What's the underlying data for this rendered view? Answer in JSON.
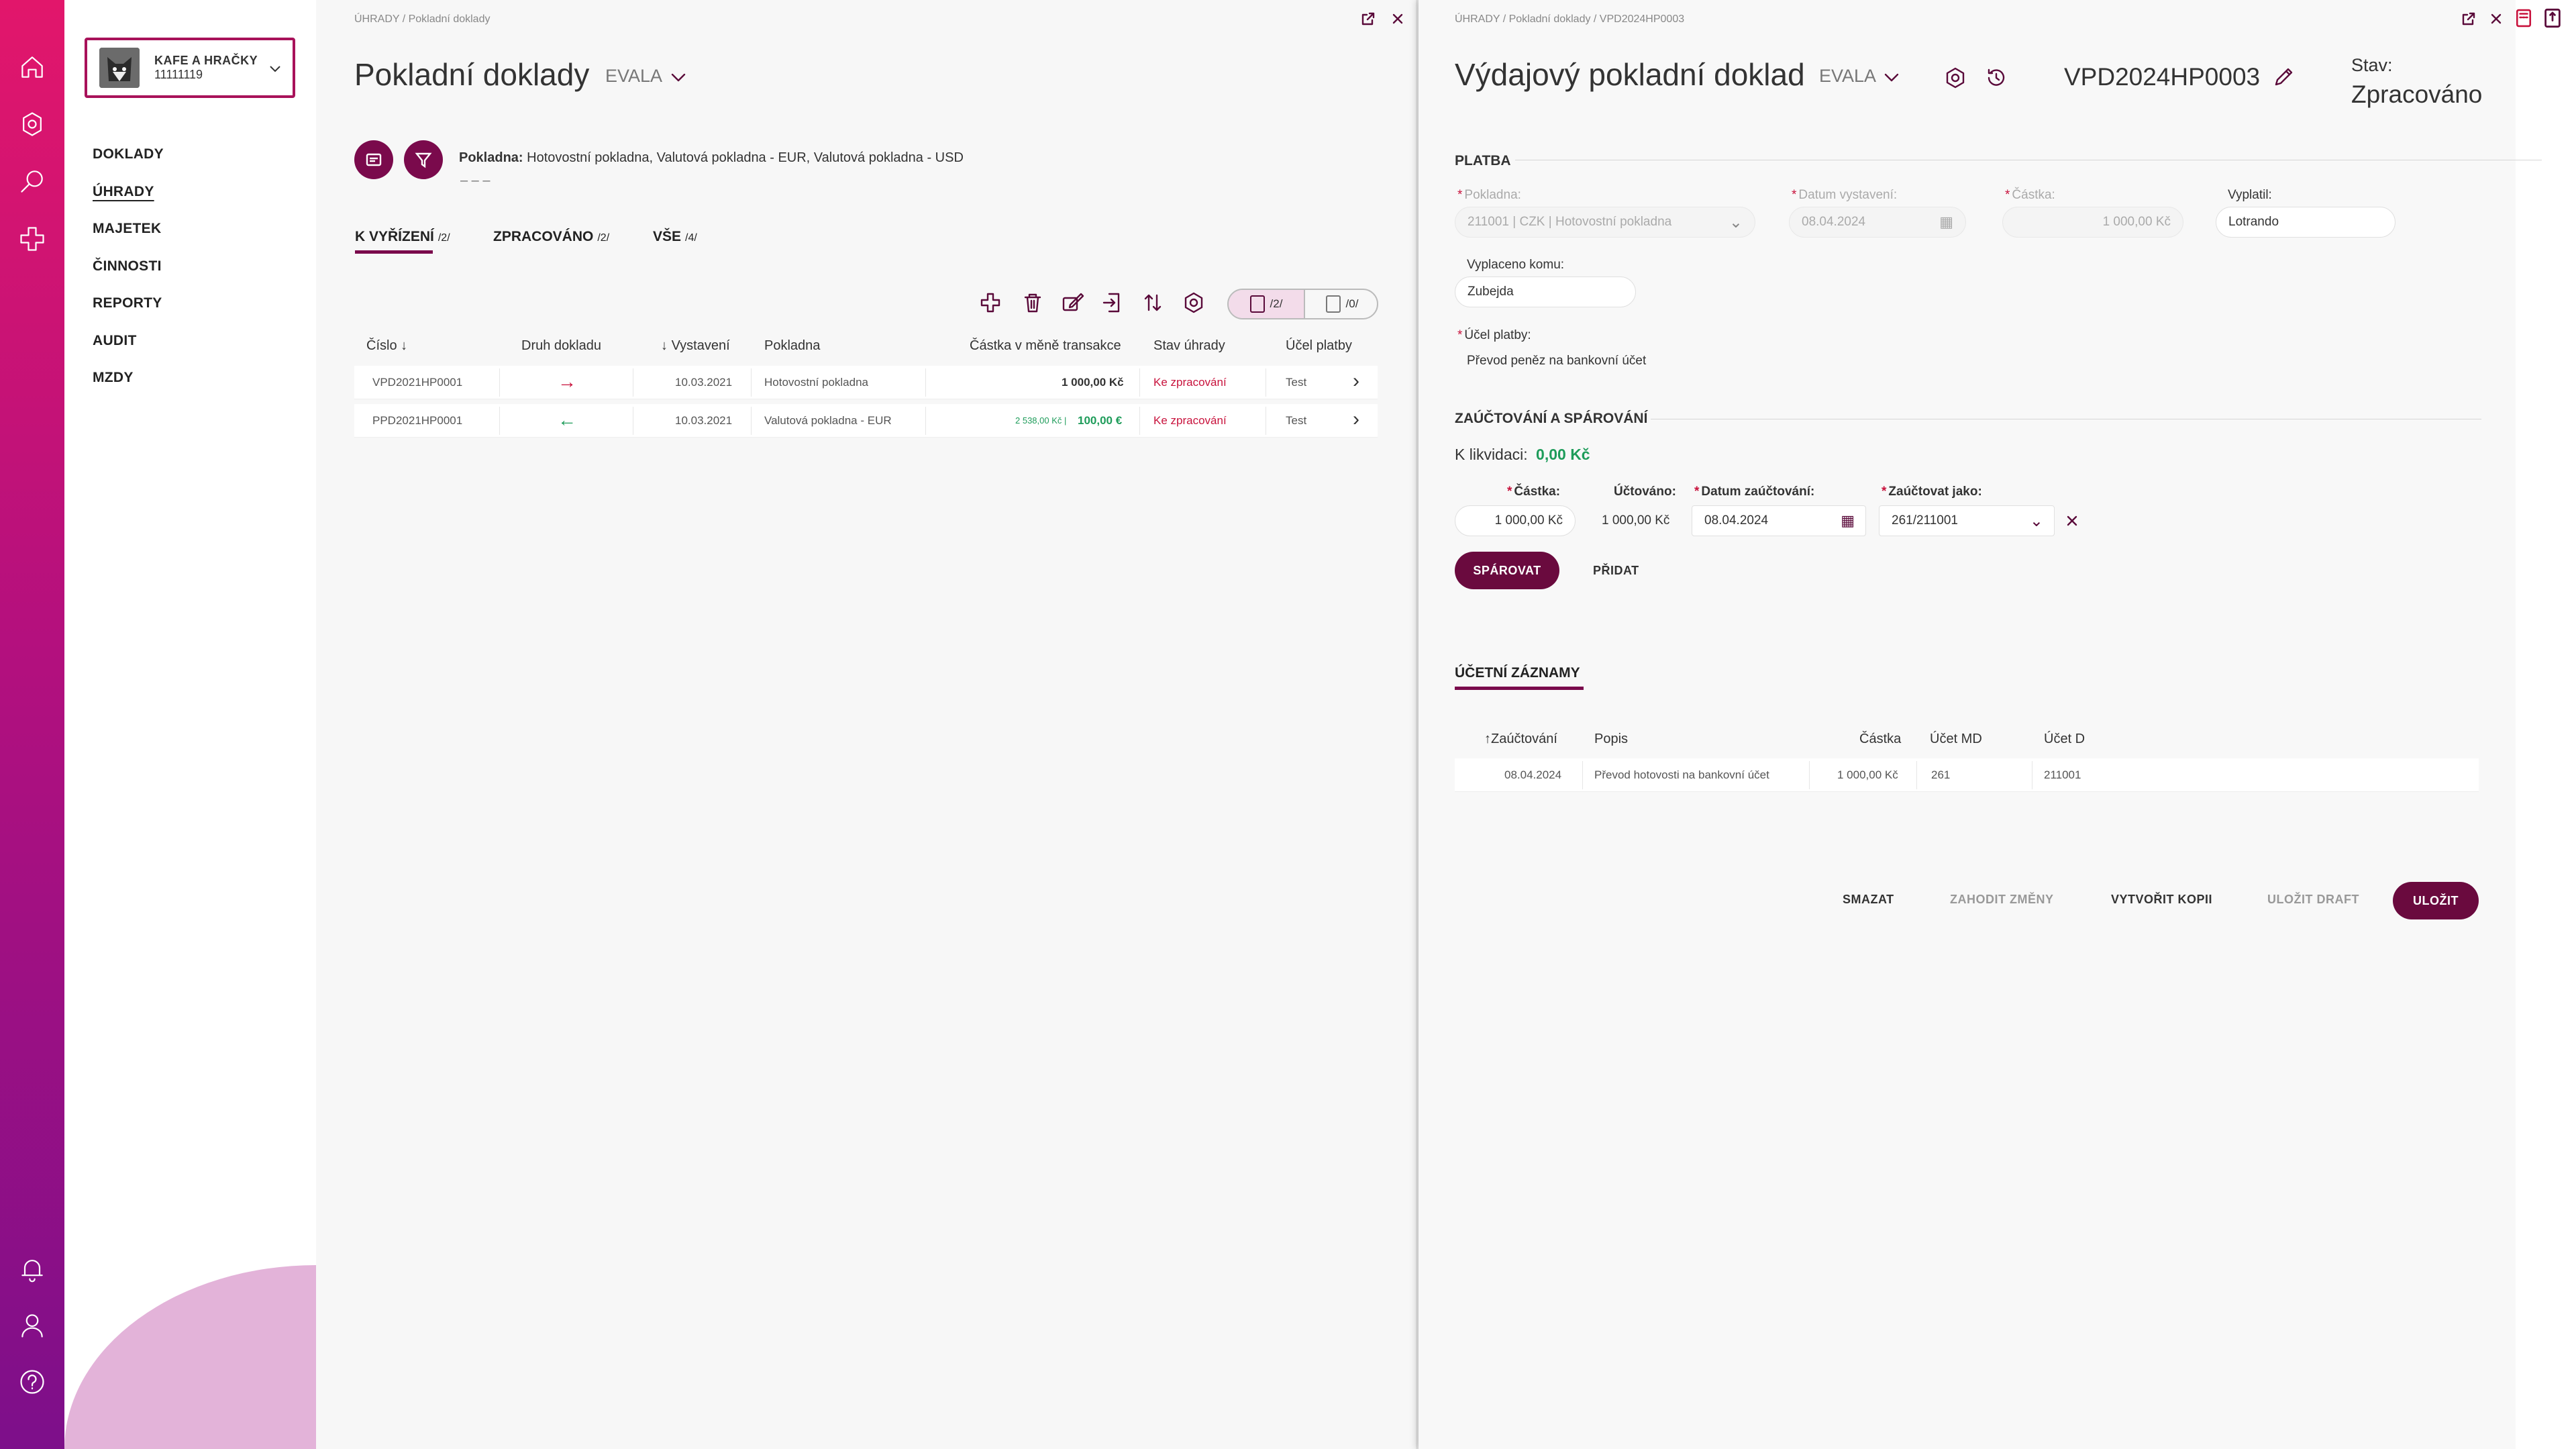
{
  "company": {
    "name": "KAFE A HRAČKY",
    "id": "11111119"
  },
  "nav": [
    "DOKLADY",
    "ÚHRADY",
    "MAJETEK",
    "ČINNOSTI",
    "REPORTY",
    "AUDIT",
    "MZDY"
  ],
  "left": {
    "breadcrumb": "ÚHRADY  /  Pokladní doklady",
    "title": "Pokladní doklady",
    "evala": "EVALA",
    "filter": {
      "label": "Pokladna:",
      "value": "Hotovostní pokladna, Valutová pokladna - EUR, Valutová pokladna - USD",
      "dashes": "– – –"
    },
    "tabs": [
      {
        "label": "K VYŘÍZENÍ",
        "count": "/2/"
      },
      {
        "label": "ZPRACOVÁNO",
        "count": "/2/"
      },
      {
        "label": "VŠE",
        "count": "/4/"
      }
    ],
    "toggle": {
      "a": "/2/",
      "b": "/0/"
    },
    "columns": [
      "Číslo",
      "Druh dokladu",
      "Vystavení",
      "Pokladna",
      "Částka v měně transakce",
      "Stav úhrady",
      "Účel platby"
    ],
    "rows": [
      {
        "cislo": "VPD2021HP0001",
        "vystaveni": "10.03.2021",
        "pokladna": "Hotovostní pokladna",
        "castka": "1 000,00 Kč",
        "castka_small": "",
        "stav": "Ke zpracování",
        "ucel": "Test",
        "direction": "out"
      },
      {
        "cislo": "PPD2021HP0001",
        "vystaveni": "10.03.2021",
        "pokladna": "Valutová pokladna - EUR",
        "castka": "100,00 €",
        "castka_small": "2 538,00 Kč |",
        "stav": "Ke zpracování",
        "ucel": "Test",
        "direction": "in"
      }
    ]
  },
  "right": {
    "breadcrumb": "ÚHRADY  /  Pokladní doklady  /  VPD2024HP0003",
    "title": "Výdajový pokladní doklad",
    "evala": "EVALA",
    "doc_number": "VPD2024HP0003",
    "status_label": "Stav:",
    "status_value": "Zpracováno",
    "platba": {
      "section": "PLATBA",
      "pokladna_label": "Pokladna:",
      "pokladna_value": "211001 | CZK | Hotovostní pokladna",
      "datum_label": "Datum vystavení:",
      "datum_value": "08.04.2024",
      "castka_label": "Částka:",
      "castka_value": "1 000,00 Kč",
      "vyplatil_label": "Vyplatil:",
      "vyplatil_value": "Lotrando",
      "komu_label": "Vyplaceno komu:",
      "komu_value": "Zubejda",
      "ucel_label": "Účel platby:",
      "ucel_value": "Převod peněz na bankovní účet"
    },
    "zauct": {
      "section": "ZAÚČTOVÁNÍ A SPÁROVÁNÍ",
      "k_likvidaci_label": "K likvidaci:",
      "k_likvidaci_value": "0,00 Kč",
      "castka_label": "Částka:",
      "castka_value": "1 000,00 Kč",
      "uctovano_label": "Účtováno:",
      "uctovano_value": "1 000,00 Kč",
      "datum_label": "Datum zaúčtování:",
      "datum_value": "08.04.2024",
      "jako_label": "Zaúčtovat jako:",
      "jako_value": "261/211001",
      "sparovat": "SPÁROVAT",
      "pridat": "PŘIDAT"
    },
    "ucetni": {
      "tab": "ÚČETNÍ ZÁZNAMY",
      "columns": [
        "Zaúčtování",
        "Popis",
        "Částka",
        "Účet MD",
        "Účet D"
      ],
      "rows": [
        {
          "datum": "08.04.2024",
          "popis": "Převod hotovosti na bankovní účet",
          "castka": "1 000,00 Kč",
          "md": "261",
          "d": "211001"
        }
      ]
    },
    "actions": {
      "smazat": "SMAZAT",
      "zahodit": "ZAHODIT ZMĚNY",
      "kopie": "VYTVOŘIT KOPII",
      "draft": "ULOŽIT DRAFT",
      "ulozit": "ULOŽIT"
    }
  },
  "colors": {
    "brand": "#7a0a4c",
    "accent": "#e2166b",
    "green": "#1e9c5a",
    "red": "#c8123c"
  }
}
